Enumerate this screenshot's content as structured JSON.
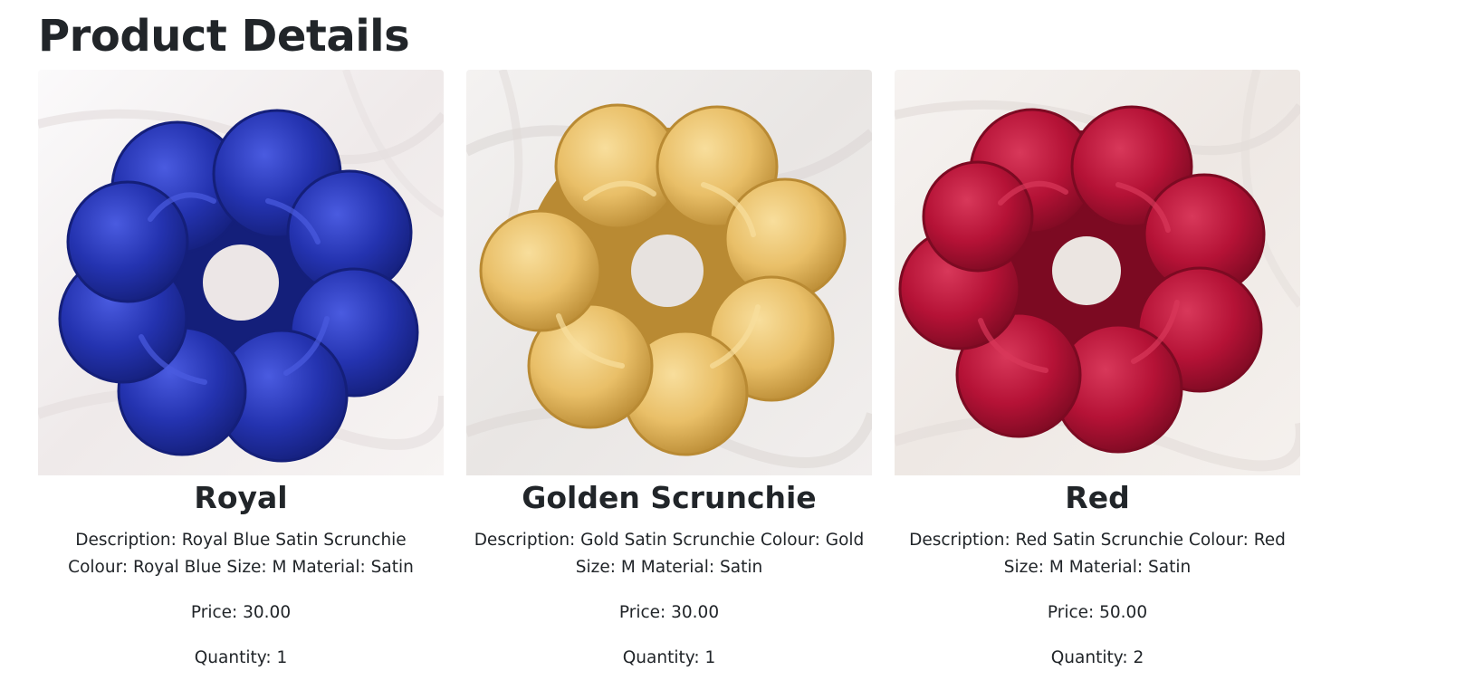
{
  "page": {
    "title": "Product Details"
  },
  "products": [
    {
      "name": "Royal",
      "description": "Description: Royal Blue Satin Scrunchie Colour: Royal Blue Size: M Material: Satin",
      "price": "Price: 30.00",
      "quantity": "Quantity: 1",
      "image_color": "#2433b0",
      "image_highlight": "#4a5be0",
      "image_shadow": "#141f7a"
    },
    {
      "name": "Golden Scrunchie",
      "description": "Description: Gold Satin Scrunchie Colour: Gold Size: M Material: Satin",
      "price": "Price: 30.00",
      "quantity": "Quantity: 1",
      "image_color": "#e9bf68",
      "image_highlight": "#f8de9c",
      "image_shadow": "#b98a33"
    },
    {
      "name": "Red",
      "description": "Description: Red Satin Scrunchie Colour: Red Size: M Material: Satin",
      "price": "Price: 50.00",
      "quantity": "Quantity: 2",
      "image_color": "#b51236",
      "image_highlight": "#d8385a",
      "image_shadow": "#7c0a22"
    }
  ]
}
